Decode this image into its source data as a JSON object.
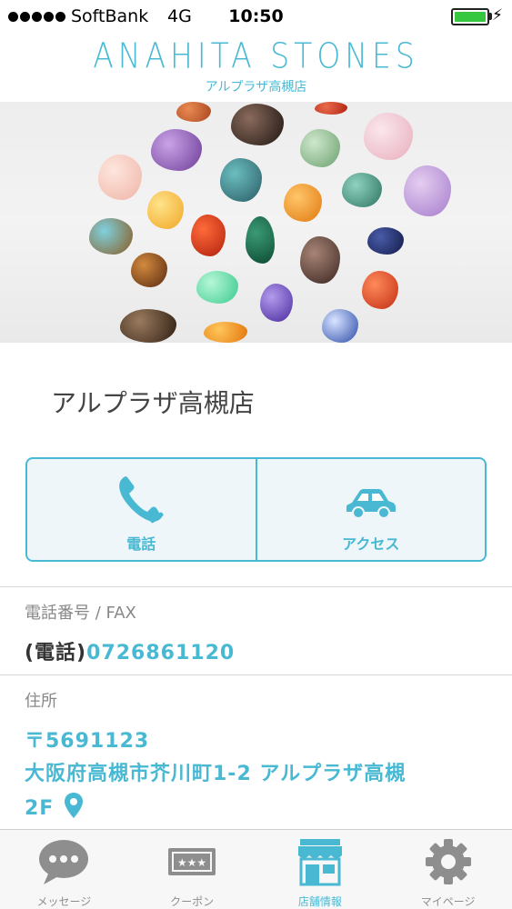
{
  "status_bar": {
    "carrier": "SoftBank",
    "network": "4G",
    "time": "10:50"
  },
  "header": {
    "logo": "ANAHITA STONES",
    "logo_sub": "アルプラザ高槻店"
  },
  "shop": {
    "name": "アルプラザ高槻店"
  },
  "actions": {
    "call_label": "電話",
    "access_label": "アクセス"
  },
  "contact": {
    "section_label": "電話番号 / FAX",
    "phone_prefix": "(電話)",
    "phone_number": "0726861120"
  },
  "address": {
    "section_label": "住所",
    "postal": "〒5691123",
    "line1": "大阪府高槻市芥川町1-2 アルプラザ高槻",
    "line2": "2F"
  },
  "tabs": [
    {
      "label": "メッセージ",
      "icon": "message-icon"
    },
    {
      "label": "クーポン",
      "icon": "coupon-icon"
    },
    {
      "label": "店舗情報",
      "icon": "store-icon"
    },
    {
      "label": "マイページ",
      "icon": "gear-icon"
    }
  ],
  "colors": {
    "accent": "#49b9d3",
    "tab_inactive": "#8e8e8e"
  }
}
